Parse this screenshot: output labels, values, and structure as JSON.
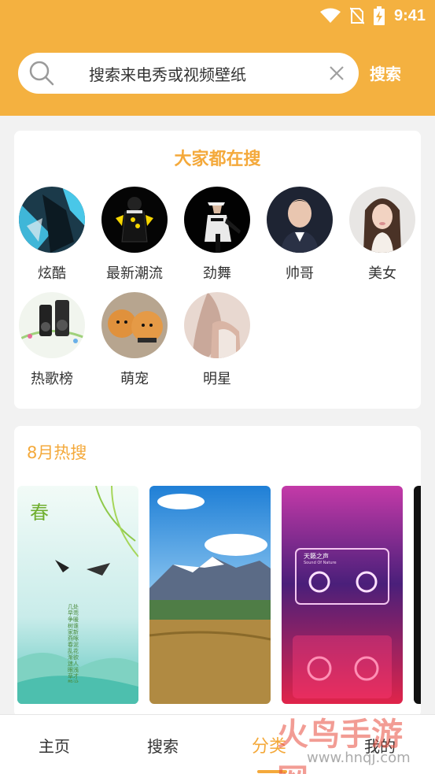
{
  "status": {
    "time": "9:41"
  },
  "search": {
    "placeholder": "搜索来电秀或视频壁纸",
    "button": "搜索"
  },
  "popular": {
    "title": "大家都在搜",
    "items": [
      {
        "label": "炫酷",
        "icon": "cool-thumbnail"
      },
      {
        "label": "最新潮流",
        "icon": "trend-thumbnail"
      },
      {
        "label": "劲舞",
        "icon": "dance-thumbnail"
      },
      {
        "label": "帅哥",
        "icon": "handsome-thumbnail"
      },
      {
        "label": "美女",
        "icon": "beauty-thumbnail"
      },
      {
        "label": "热歌榜",
        "icon": "hot-songs-thumbnail"
      },
      {
        "label": "萌宠",
        "icon": "cute-pets-thumbnail"
      },
      {
        "label": "明星",
        "icon": "stars-thumbnail"
      }
    ]
  },
  "hot": {
    "title": "8月热搜",
    "wallpapers": [
      {
        "caption": "春",
        "poem": "几处早莺争暖树谁家新燕啄春泥乱花渐欲迷人眼浅草才能没马蹄"
      },
      {
        "caption": ""
      },
      {
        "caption": "天籁之声",
        "subcaption": "Sound Of Nature"
      }
    ]
  },
  "tabs": [
    {
      "label": "主页"
    },
    {
      "label": "搜索"
    },
    {
      "label": "分类"
    },
    {
      "label": "我的"
    }
  ],
  "watermark": {
    "text": "火鸟手游网",
    "url": "www.hnqj.com"
  },
  "colors": {
    "accent": "#f4b140",
    "accent_text": "#f4a93b"
  }
}
